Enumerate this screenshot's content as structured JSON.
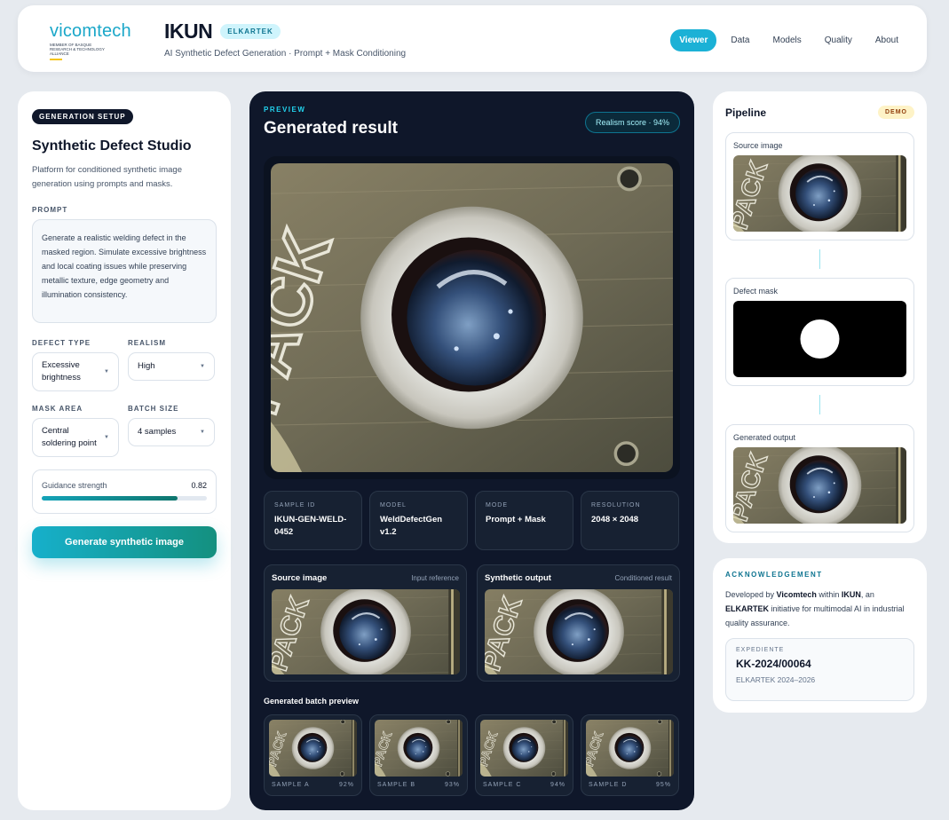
{
  "brand": {
    "logo_text": "vicomtech",
    "logo_sub": "MEMBER OF BASQUE RESEARCH & TECHNOLOGY ALLIANCE",
    "title": "IKUN",
    "badge": "ELKARTEK",
    "subtitle": "AI Synthetic Defect Generation · Prompt + Mask Conditioning"
  },
  "nav": {
    "items": [
      "Viewer",
      "Data",
      "Models",
      "Quality",
      "About"
    ],
    "active": "Viewer"
  },
  "setup": {
    "badge": "GENERATION SETUP",
    "title": "Synthetic Defect Studio",
    "description": "Platform for conditioned synthetic image generation using prompts and masks.",
    "prompt_label": "PROMPT",
    "prompt_text": "Generate a realistic welding defect in the masked region. Simulate excessive brightness and local coating issues while preserving metallic texture, edge geometry and illumination consistency.",
    "defect_type_label": "DEFECT TYPE",
    "defect_type_value": "Excessive brightness",
    "realism_label": "REALISM",
    "realism_value": "High",
    "mask_area_label": "MASK AREA",
    "mask_area_value": "Central soldering point",
    "batch_size_label": "BATCH SIZE",
    "batch_size_value": "4 samples",
    "guidance_label": "Guidance strength",
    "guidance_value": "0.82",
    "generate_label": "Generate synthetic image"
  },
  "preview": {
    "label": "PREVIEW",
    "title": "Generated result",
    "realism_score": "Realism score · 94%",
    "meta": [
      {
        "key": "SAMPLE ID",
        "value": "IKUN-GEN-WELD-0452"
      },
      {
        "key": "MODEL",
        "value": "WeldDefectGen v1.2"
      },
      {
        "key": "MODE",
        "value": "Prompt + Mask"
      },
      {
        "key": "RESOLUTION",
        "value": "2048 × 2048"
      }
    ],
    "source": {
      "title": "Source image",
      "subtitle": "Input reference"
    },
    "output": {
      "title": "Synthetic output",
      "subtitle": "Conditioned result"
    },
    "batch_label": "Generated batch preview",
    "batch": [
      {
        "name": "SAMPLE A",
        "score": "92%"
      },
      {
        "name": "SAMPLE B",
        "score": "93%"
      },
      {
        "name": "SAMPLE C",
        "score": "94%"
      },
      {
        "name": "SAMPLE D",
        "score": "95%"
      }
    ]
  },
  "pipeline": {
    "title": "Pipeline",
    "badge": "DEMO",
    "steps": [
      "Source image",
      "Defect mask",
      "Generated output"
    ]
  },
  "ack": {
    "label": "ACKNOWLEDGEMENT",
    "t1": "Developed by ",
    "b1": "Vicomtech",
    "t2": " within ",
    "b2": "IKUN",
    "t3": ", an ",
    "b3": "ELKARTEK",
    "t4": " initiative for multimodal AI in industrial quality assurance.",
    "exp_label": "EXPEDIENTE",
    "exp_code": "KK-2024/00064",
    "exp_years": "ELKARTEK 2024–2026"
  },
  "colors": {
    "accent": "#1bb1d6",
    "dark": "#0f172a",
    "teal": "#14907f"
  }
}
